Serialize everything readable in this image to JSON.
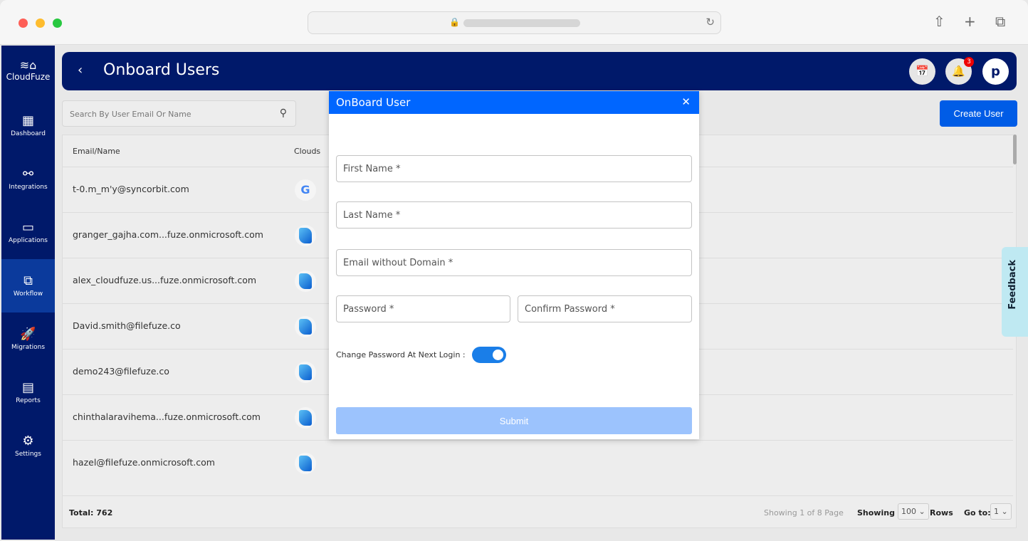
{
  "app": {
    "logo": "CloudFuze",
    "title": "Onboard Users"
  },
  "sidebar": [
    {
      "label": "Dashboard",
      "icon": "▦"
    },
    {
      "label": "Integrations",
      "icon": "⚯"
    },
    {
      "label": "Applications",
      "icon": "▭"
    },
    {
      "label": "Workflow",
      "icon": "⧉"
    },
    {
      "label": "Migrations",
      "icon": "🚀"
    },
    {
      "label": "Reports",
      "icon": "▤"
    },
    {
      "label": "Settings",
      "icon": "⚙"
    }
  ],
  "header": {
    "notifications": "3",
    "avatar": "p"
  },
  "search": {
    "placeholder": "Search By User Email Or Name"
  },
  "create_user": "Create User",
  "table": {
    "headers": [
      "Email/Name",
      "Clouds"
    ],
    "rows": [
      {
        "email": "t-0.m_m'y@syncorbit.com",
        "cloud": "google"
      },
      {
        "email": "granger_gajha.com...fuze.onmicrosoft.com",
        "cloud": "onedrive"
      },
      {
        "email": "alex_cloudfuze.us...fuze.onmicrosoft.com",
        "cloud": "onedrive"
      },
      {
        "email": "David.smith@filefuze.co",
        "cloud": "onedrive"
      },
      {
        "email": "demo243@filefuze.co",
        "cloud": "onedrive"
      },
      {
        "email": "chinthalaravihema...fuze.onmicrosoft.com",
        "cloud": "onedrive"
      },
      {
        "email": "hazel@filefuze.onmicrosoft.com",
        "cloud": "onedrive"
      }
    ]
  },
  "footer": {
    "total": "Total: 762",
    "page_info": "Showing 1 of 8 Page",
    "showing_label": "Showing :",
    "rows_value": "100",
    "rows_label": "Rows",
    "goto_label": "Go to:",
    "goto_value": "1"
  },
  "feedback": "Feedback",
  "modal": {
    "title": "OnBoard User",
    "first_name": "First Name *",
    "last_name": "Last Name *",
    "email": "Email without Domain *",
    "password": "Password *",
    "confirm": "Confirm Password *",
    "change_pw_label": "Change Password At Next Login :",
    "change_pw_on": true,
    "submit": "Submit"
  }
}
